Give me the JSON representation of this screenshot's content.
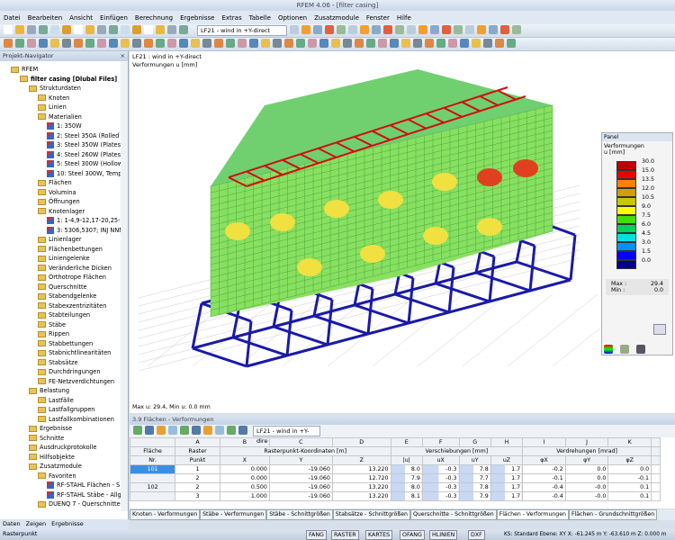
{
  "window": {
    "title": "RFEM 4.06 - [filter casing]"
  },
  "menu": [
    "Datei",
    "Bearbeiten",
    "Ansicht",
    "Einfügen",
    "Berechnung",
    "Ergebnisse",
    "Extras",
    "Tabelle",
    "Optionen",
    "Zusatzmodule",
    "Fenster",
    "Hilfe"
  ],
  "toolbar": {
    "loadcase": "LF21 - wind in +Y-direct"
  },
  "navigator": {
    "title": "Projekt-Navigator",
    "items": [
      {
        "label": "RFEM",
        "level": 0
      },
      {
        "label": "filter casing [Dlubal Files]",
        "level": 1,
        "bold": true
      },
      {
        "label": "Strukturdaten",
        "level": 2
      },
      {
        "label": "Knoten",
        "level": 3
      },
      {
        "label": "Linien",
        "level": 3
      },
      {
        "label": "Materialien",
        "level": 3
      },
      {
        "label": "1: 350W",
        "level": 4,
        "mat": true
      },
      {
        "label": "2: Steel 350A (Rolled S",
        "level": 4,
        "mat": true
      },
      {
        "label": "3: Steel 350W (Plates),",
        "level": 4,
        "mat": true
      },
      {
        "label": "4: Steel 260W (Plates, S",
        "level": 4,
        "mat": true
      },
      {
        "label": "5: Steel 300W (Hollow",
        "level": 4,
        "mat": true
      },
      {
        "label": "10: Steel 300W, Temp",
        "level": 4,
        "mat": true
      },
      {
        "label": "Flächen",
        "level": 3
      },
      {
        "label": "Volumina",
        "level": 3
      },
      {
        "label": "Öffnungen",
        "level": 3
      },
      {
        "label": "Knotenlager",
        "level": 3
      },
      {
        "label": "1: 1-4,9-12,17-20,25-28",
        "level": 4,
        "mat": true
      },
      {
        "label": "3: 5306,5307; INJ NNN",
        "level": 4,
        "mat": true
      },
      {
        "label": "Linienlager",
        "level": 3
      },
      {
        "label": "Flächenbettungen",
        "level": 3
      },
      {
        "label": "Liniengelenke",
        "level": 3
      },
      {
        "label": "Veränderliche Dicken",
        "level": 3
      },
      {
        "label": "Orthotrope Flächen",
        "level": 3
      },
      {
        "label": "Querschnitte",
        "level": 3
      },
      {
        "label": "Stabendgelenke",
        "level": 3
      },
      {
        "label": "Stabexzentrizitäten",
        "level": 3
      },
      {
        "label": "Stabteilungen",
        "level": 3
      },
      {
        "label": "Stäbe",
        "level": 3
      },
      {
        "label": "Rippen",
        "level": 3
      },
      {
        "label": "Stabbettungen",
        "level": 3
      },
      {
        "label": "Stabnichtlinearitäten",
        "level": 3
      },
      {
        "label": "Stabsätze",
        "level": 3
      },
      {
        "label": "Durchdringungen",
        "level": 3
      },
      {
        "label": "FE-Netzverdichtungen",
        "level": 3
      },
      {
        "label": "Belastung",
        "level": 2
      },
      {
        "label": "Lastfälle",
        "level": 3
      },
      {
        "label": "Lastfallgruppen",
        "level": 3
      },
      {
        "label": "Lastfallkombinationen",
        "level": 3
      },
      {
        "label": "Ergebnisse",
        "level": 2
      },
      {
        "label": "Schnitte",
        "level": 2
      },
      {
        "label": "Ausdruckprotokolle",
        "level": 2
      },
      {
        "label": "Hilfsobjekte",
        "level": 2
      },
      {
        "label": "Zusatzmodule",
        "level": 2
      },
      {
        "label": "Favoriten",
        "level": 3
      },
      {
        "label": "RF-STAHL Flächen - S",
        "level": 4,
        "mat": true
      },
      {
        "label": "RF-STAHL Stäbe - Allg",
        "level": 4,
        "mat": true
      },
      {
        "label": "DUENQ 7 - Querschnitte",
        "level": 3
      }
    ],
    "tabs": [
      "Daten",
      "Zeigen",
      "Ergebnisse"
    ]
  },
  "viewport": {
    "line1": "LF21 : wind in +Y-direct",
    "line2": "Verformungen u [mm]",
    "footer": "Max u: 29.4, Min u: 0.0 mm"
  },
  "panel": {
    "title": "Panel",
    "heading1": "Verformungen",
    "heading2": "u [mm]",
    "scale": [
      {
        "v": "30.0",
        "c": "#c00000"
      },
      {
        "v": "15.0",
        "c": "#ee0000"
      },
      {
        "v": "13.5",
        "c": "#ff8000"
      },
      {
        "v": "12.0",
        "c": "#d0a000"
      },
      {
        "v": "10.5",
        "c": "#c8c800"
      },
      {
        "v": "9.0",
        "c": "#ffff00"
      },
      {
        "v": "7.5",
        "c": "#40e000"
      },
      {
        "v": "6.0",
        "c": "#00d060"
      },
      {
        "v": "4.5",
        "c": "#00e0e0"
      },
      {
        "v": "3.0",
        "c": "#0090ff"
      },
      {
        "v": "1.5",
        "c": "#0000ff"
      },
      {
        "v": "0.0",
        "c": "#000090"
      }
    ],
    "max_label": "Max :",
    "max": "29.4",
    "min_label": "Min :",
    "min": "0.0"
  },
  "table": {
    "title": "3.9 Flächen - Verformungen",
    "loadcase": "LF21 - wind in +Y-dire",
    "cols": [
      "A",
      "B",
      "C",
      "D",
      "E",
      "F",
      "G",
      "H",
      "I",
      "J",
      "K"
    ],
    "h1": [
      "Fläche",
      "Raster",
      "Rasterpunkt-Koordinaten [m]",
      "Verschiebungen [mm]",
      "Verdrehungen [mrad]"
    ],
    "h2": [
      "Nr.",
      "Punkt",
      "X",
      "Y",
      "Z",
      "|u|",
      "uX",
      "uY",
      "uZ",
      "φX",
      "φY",
      "φZ"
    ],
    "rows": [
      [
        "101",
        "1",
        "0.000",
        "-19.060",
        "13.220",
        "8.0",
        "-0.3",
        "7.8",
        "1.7",
        "-0.2",
        "0.0",
        "0.0"
      ],
      [
        "",
        "2",
        "0.000",
        "-19.060",
        "12.720",
        "7.9",
        "-0.3",
        "7.7",
        "1.7",
        "-0.1",
        "0.0",
        "-0.1"
      ],
      [
        "102",
        "2",
        "0.500",
        "-19.060",
        "13.220",
        "8.0",
        "-0.3",
        "7.8",
        "1.7",
        "-0.4",
        "-0.0",
        "0.1"
      ],
      [
        "",
        "3",
        "1.000",
        "-19.060",
        "13.220",
        "8.1",
        "-0.3",
        "7.9",
        "1.7",
        "-0.4",
        "-0.0",
        "0.1"
      ]
    ]
  },
  "result_tabs": [
    "Knoten - Verformungen",
    "Stäbe - Verformungen",
    "Stäbe - Schnittgrößen",
    "Stabsätze - Schnittgrößen",
    "Querschnitte - Schnittgrößen",
    "Flächen - Verformungen",
    "Flächen - Grundschnittgrößen"
  ],
  "active_result_tab": 5,
  "status": {
    "left": "Rasterpunkt",
    "toggles": [
      "FANG",
      "RASTER",
      "KARTES",
      "OFANG",
      "HLINIEN",
      "DXF"
    ],
    "coords": "KS: Standard  Ebene: XY  X: -61.245 m   Y: -63.610 m   Z: 0.000 m"
  }
}
